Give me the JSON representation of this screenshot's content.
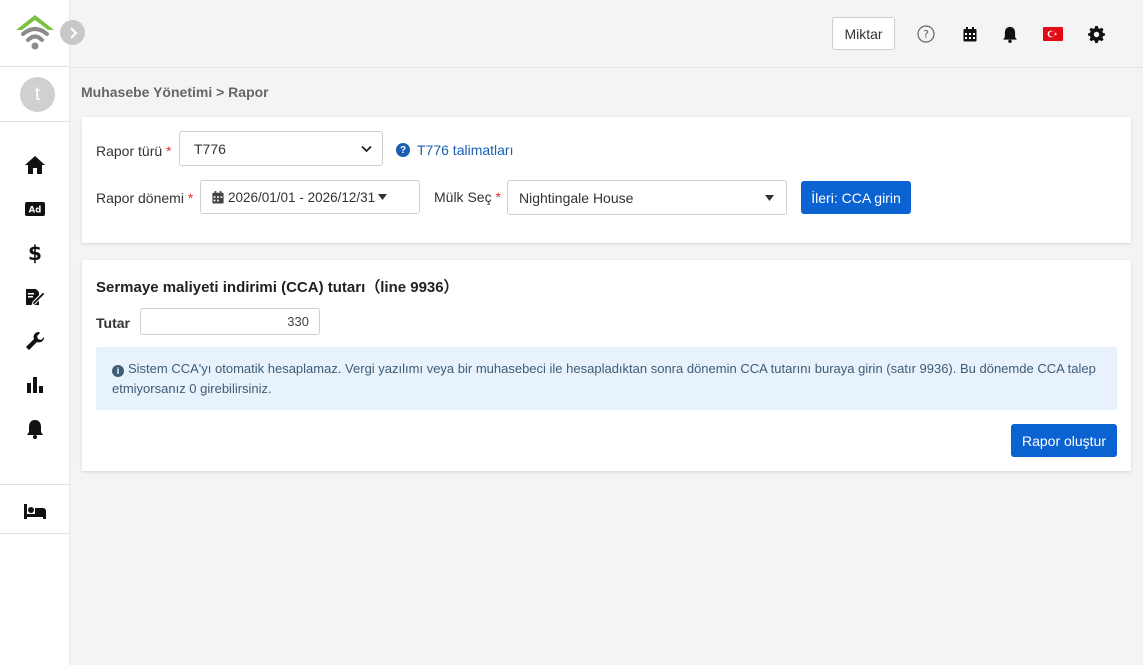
{
  "sidebar": {
    "avatar_letter": "t",
    "icons": [
      "home-icon",
      "ad-icon",
      "dollar-icon",
      "document-edit-icon",
      "wrench-icon",
      "bar-chart-icon",
      "bell-icon",
      "bed-icon"
    ]
  },
  "header": {
    "miktar_label": "Miktar",
    "icons": [
      "help-icon",
      "calendar-icon",
      "bell-icon",
      "turkey-flag-icon",
      "gear-icon"
    ]
  },
  "breadcrumb": "Muhasebe Yönetimi > Rapor",
  "filters": {
    "report_type_label": "Rapor türü",
    "report_type_value": "T776",
    "instructions_link": "T776 talimatları",
    "period_label": "Rapor dönemi",
    "period_value": "2026/01/01 - 2026/12/31",
    "property_label": "Mülk Seç",
    "property_value": "Nightingale House",
    "next_button": "İleri: CCA girin",
    "required_mark": "*"
  },
  "cca": {
    "title": "Sermaye maliyeti indirimi (CCA) tutarı（line 9936）",
    "amount_label": "Tutar",
    "amount_value": "330",
    "info_text": "Sistem CCA'yı otomatik hesaplamaz. Vergi yazılımı veya bir muhasebeci ile hesapladıktan sonra dönemin CCA tutarını buraya girin (satır 9936). Bu dönemde CCA talep etmiyorsanız 0 girebilirsiniz.",
    "create_button": "Rapor oluştur"
  },
  "colors": {
    "primary": "#0b62d1",
    "logo_green": "#7cc242",
    "logo_gray": "#8a8a8a",
    "alert_bg": "#e8f2fc",
    "required": "#d9332d"
  }
}
